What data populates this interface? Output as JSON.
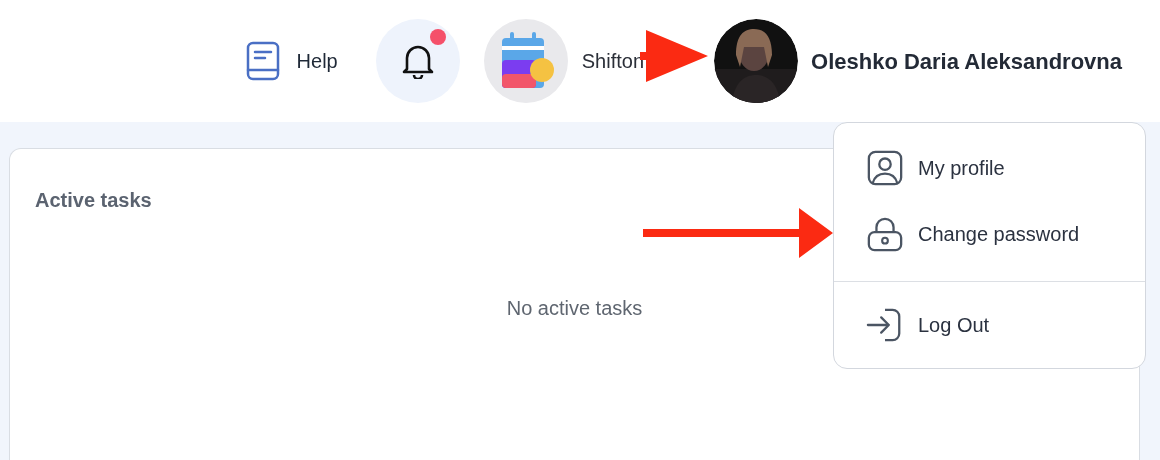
{
  "header": {
    "help": {
      "label": "Help"
    },
    "notifications": {
      "unread": true
    },
    "company": {
      "name": "Shifton"
    },
    "user": {
      "name": "Oleshko Daria Aleksandrovna"
    }
  },
  "tasks_card": {
    "title": "Active tasks",
    "empty_text": "No active tasks"
  },
  "user_menu": {
    "sections": [
      [
        {
          "kind": "profile",
          "label": "My profile"
        },
        {
          "kind": "password",
          "label": "Change password"
        }
      ],
      [
        {
          "kind": "logout",
          "label": "Log Out"
        }
      ]
    ]
  }
}
